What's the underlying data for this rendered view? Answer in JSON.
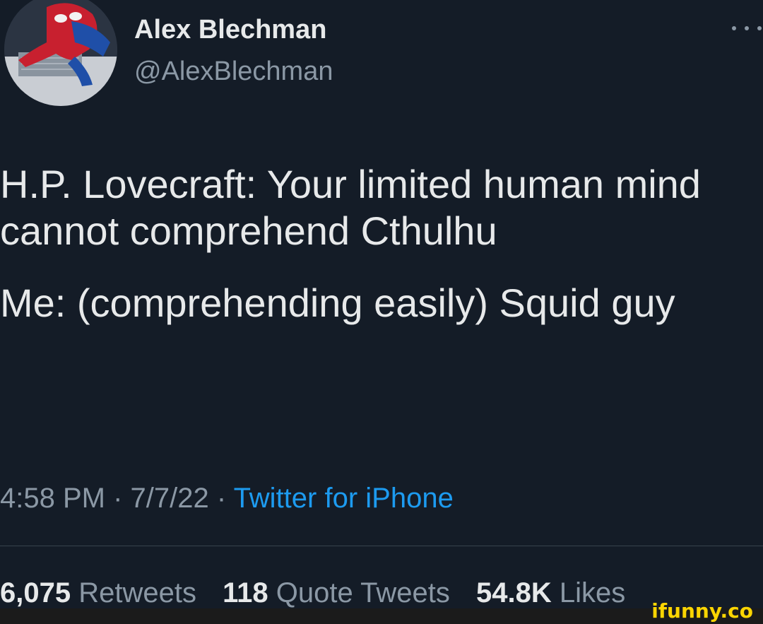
{
  "tweet": {
    "author_name": "Alex Blechman",
    "author_handle": "@AlexBlechman",
    "avatar_icon": "spider-man-avatar-icon",
    "more_icon": "more-options-icon",
    "text_lines": [
      "H.P. Lovecraft: Your limited human mind cannot comprehend Cthulhu",
      "Me: (comprehending easily) Squid guy"
    ],
    "time": "4:58 PM",
    "date": "7/7/22",
    "separator": " · ",
    "source": "Twitter for iPhone",
    "stats": {
      "retweets_count": "6,075",
      "retweets_label": "Retweets",
      "quotes_count": "118",
      "quotes_label": "Quote Tweets",
      "likes_count": "54.8K",
      "likes_label": "Likes"
    }
  },
  "watermark": "ifunny.co",
  "colors": {
    "background": "#141c27",
    "primary_text": "#e7e9ea",
    "secondary_text": "#8b98a5",
    "link": "#1d9bf0",
    "watermark": "#fcd502"
  }
}
